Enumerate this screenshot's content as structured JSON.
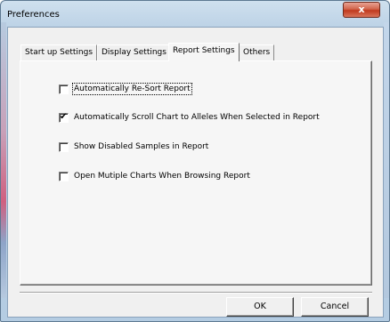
{
  "window": {
    "title": "Preferences",
    "close_glyph": "x"
  },
  "tabs": [
    {
      "label": "Start up Settings",
      "active": false
    },
    {
      "label": "Display Settings",
      "active": false
    },
    {
      "label": "Report Settings",
      "active": true
    },
    {
      "label": "Others",
      "active": false
    }
  ],
  "report_settings": {
    "options": [
      {
        "label": "Automatically Re-Sort Report",
        "checked": false
      },
      {
        "label": "Automatically Scroll Chart to Alleles When Selected in Report",
        "checked": true
      },
      {
        "label": "Show Disabled Samples in Report",
        "checked": false
      },
      {
        "label": "Open Mutiple Charts When Browsing Report",
        "checked": false
      }
    ]
  },
  "buttons": {
    "ok_label": "OK",
    "cancel_label": "Cancel"
  },
  "icons": {
    "close": "close-icon",
    "checkmark": "checkmark-icon"
  }
}
